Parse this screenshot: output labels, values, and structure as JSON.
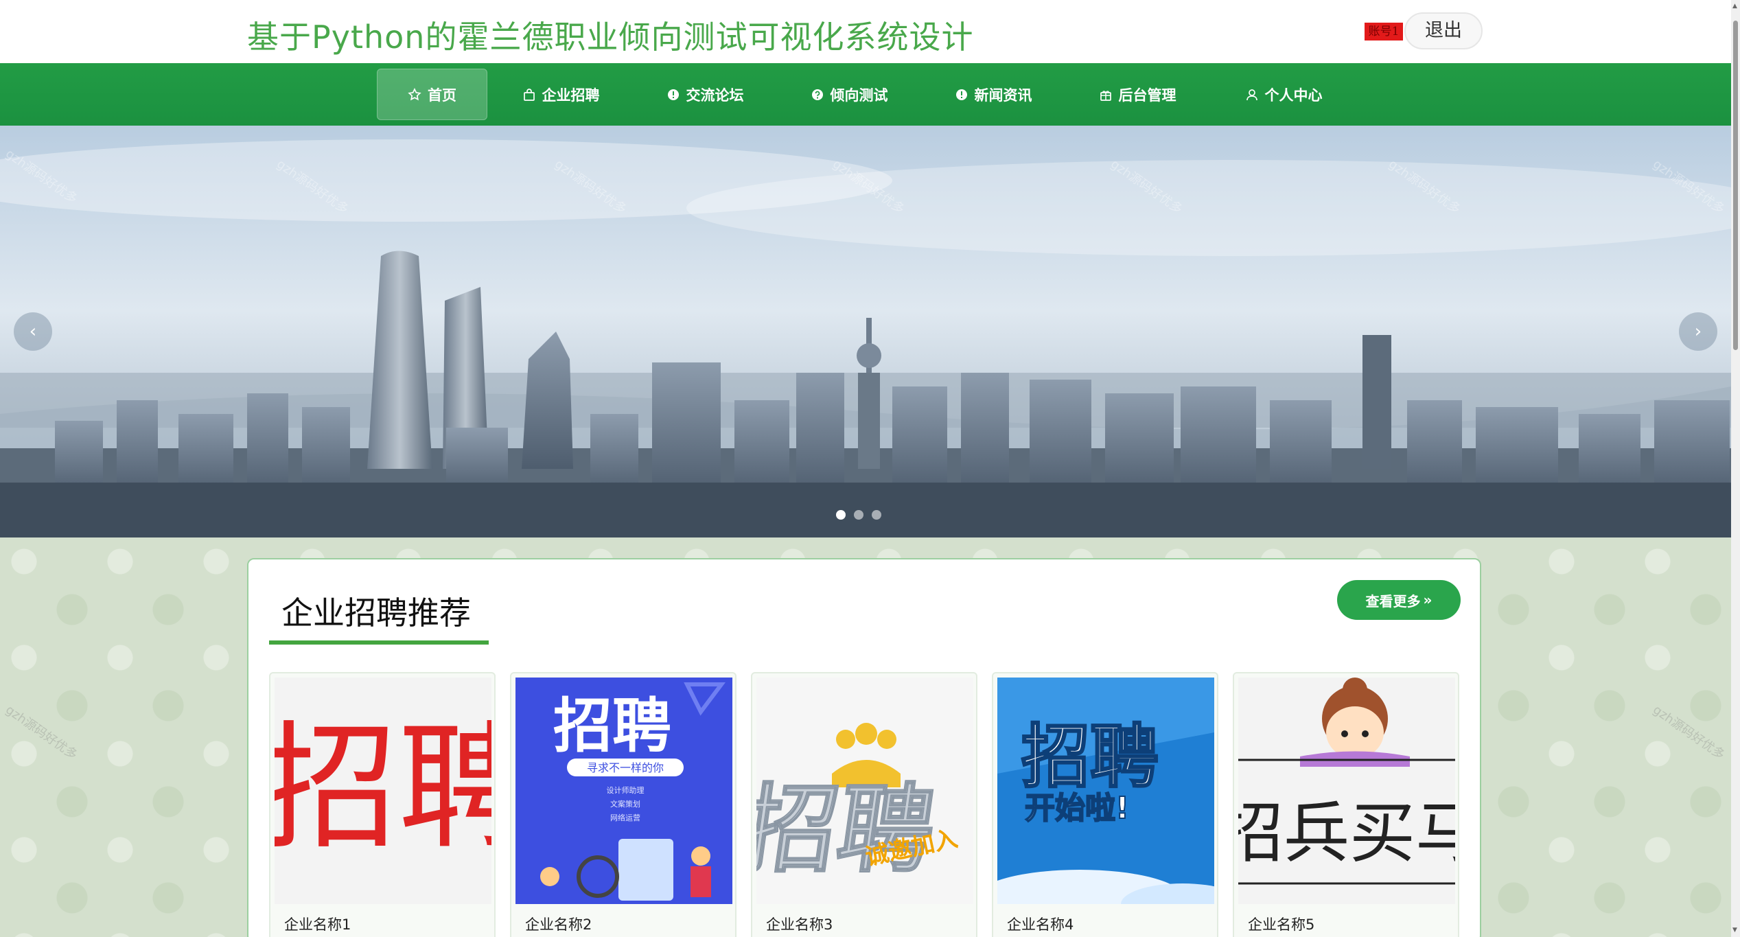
{
  "header": {
    "title": "基于Python的霍兰德职业倾向测试可视化系统设计",
    "account_label": "账号1",
    "logout_label": "退出"
  },
  "nav": {
    "items": [
      {
        "label": "首页",
        "icon": "star-icon",
        "active": true
      },
      {
        "label": "企业招聘",
        "icon": "bag-icon"
      },
      {
        "label": "交流论坛",
        "icon": "info-icon"
      },
      {
        "label": "倾向测试",
        "icon": "question-icon"
      },
      {
        "label": "新闻资讯",
        "icon": "info-icon"
      },
      {
        "label": "后台管理",
        "icon": "gift-icon"
      },
      {
        "label": "个人中心",
        "icon": "user-icon"
      }
    ]
  },
  "banner": {
    "prev_icon": "‹",
    "next_icon": "›",
    "watermark": "gzh源码好优多",
    "slide_count": 3,
    "active_slide": 1
  },
  "section": {
    "title": "企业招聘推荐",
    "more_label": "查看更多",
    "more_icon": "»",
    "companies": [
      {
        "name": "企业名称1",
        "poster_text": "招聘"
      },
      {
        "name": "企业名称2",
        "poster_text": "招聘",
        "poster_sub": "寻求不一样的你",
        "poster_lines": [
          "设计师助理",
          "文案策划",
          "网络运营"
        ]
      },
      {
        "name": "企业名称3",
        "poster_text": "招聘",
        "poster_sub": "诚邀加入"
      },
      {
        "name": "企业名称4",
        "poster_text": "招聘",
        "poster_sub": "开始啦!"
      },
      {
        "name": "企业名称5",
        "poster_text": "招兵买马"
      }
    ]
  },
  "colors": {
    "brand_green": "#229c45",
    "title_green": "#49a84b",
    "button_green": "#2aa54c"
  }
}
